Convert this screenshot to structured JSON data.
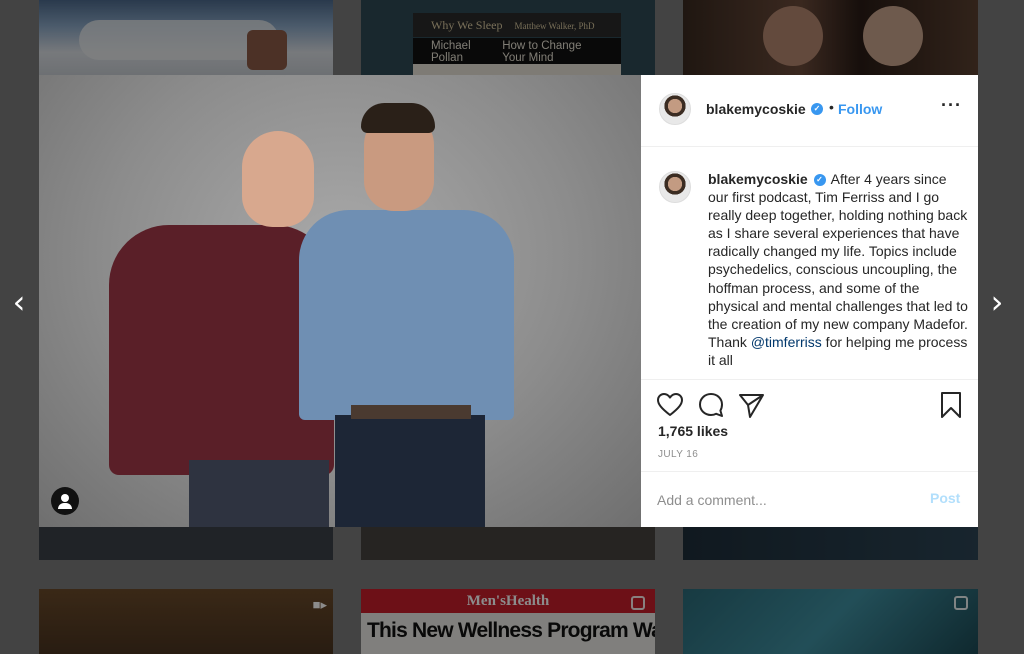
{
  "background": {
    "books": {
      "book1": "Why We Sleep",
      "book1_author": "Matthew Walker, PhD",
      "book2_author": "Michael Pollan",
      "book2_title": "How to Change Your Mind"
    },
    "magazine": {
      "masthead": "Men'sHealth",
      "headline": "This New Wellness Program Wants to"
    }
  },
  "post": {
    "username": "blakemycoskie",
    "verified_mark": "✓",
    "dot": "•",
    "follow_label": "Follow",
    "more_label": "···",
    "caption_text_1": "After 4 years since our first podcast, Tim Ferriss and I go really deep together, holding nothing back as I share several experiences that have radically changed my life. Topics include psychedelics, conscious uncoupling, the hoffman process, and some of the physical and mental challenges that led to the creation of my new company Madefor. Thank ",
    "caption_mention": "@timferriss",
    "caption_text_2": " for helping me process it all",
    "likes": "1,765 likes",
    "date": "JULY 16",
    "comment_placeholder": "Add a comment...",
    "post_label": "Post"
  },
  "nav": {
    "prev": "‹",
    "next": "›"
  },
  "icons": {
    "like": "heart-icon",
    "comment": "comment-icon",
    "share": "paper-plane-icon",
    "save": "bookmark-icon",
    "tag": "user-tag-icon"
  },
  "colors": {
    "accent": "#3897f0",
    "post_disabled": "#b2dffc",
    "text": "#262626",
    "muted": "#8e8e8e"
  }
}
